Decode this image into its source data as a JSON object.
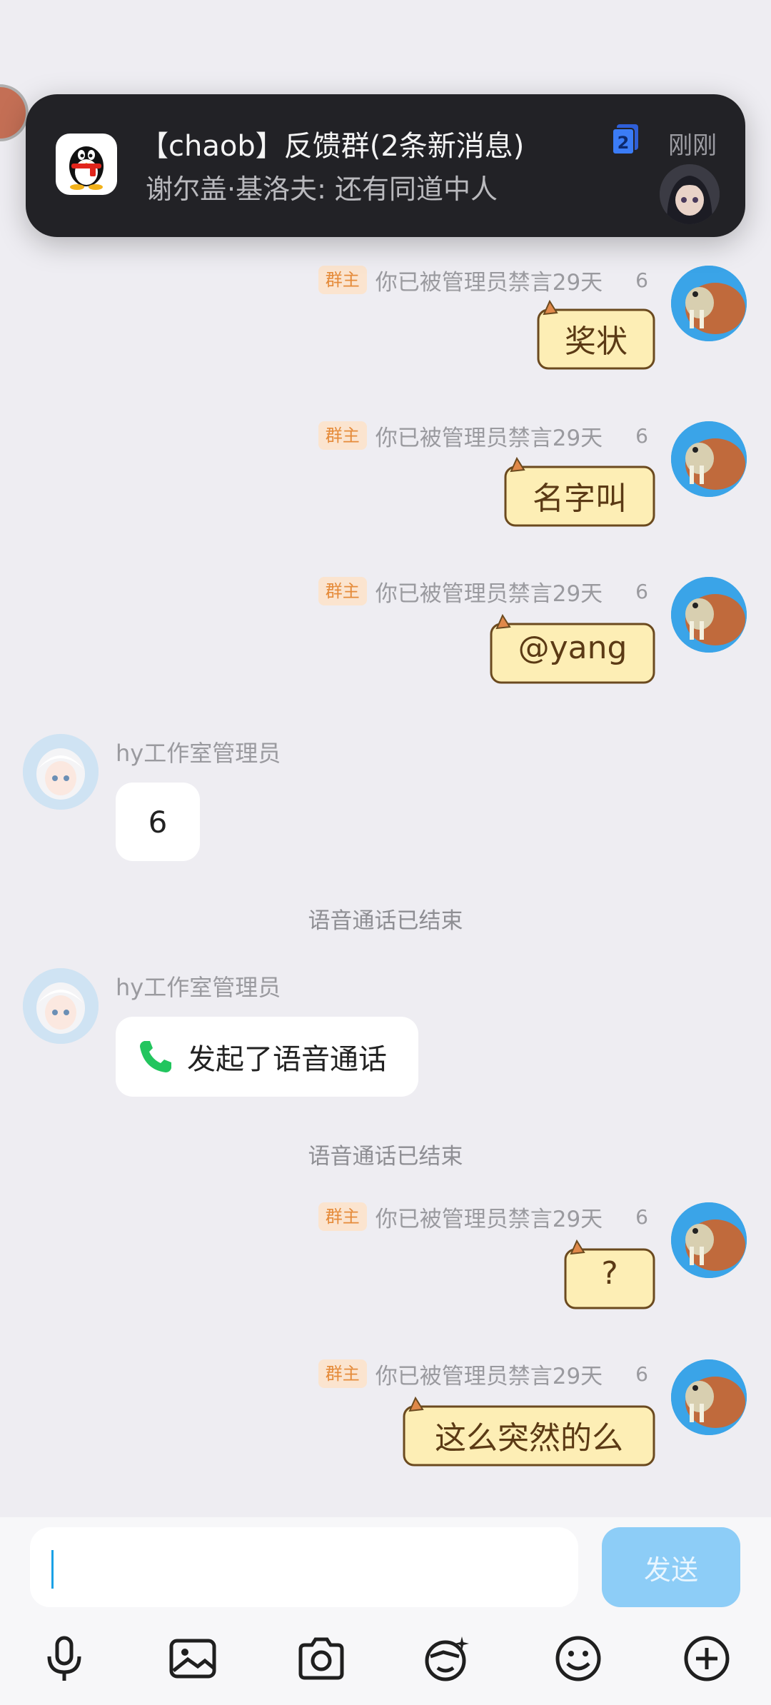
{
  "notification": {
    "title": "【chaob】反馈群(2条新消息)",
    "body": "谢尔盖·基洛夫: 还有同道中人",
    "count": "2",
    "time": "刚刚"
  },
  "messages": [
    {
      "badge": "群主",
      "status": "你已被管理员禁言29天",
      "level": "6",
      "text": "奖状"
    },
    {
      "badge": "群主",
      "status": "你已被管理员禁言29天",
      "level": "6",
      "text": "名字叫"
    },
    {
      "badge": "群主",
      "status": "你已被管理员禁言29天",
      "level": "6",
      "text": "@yang"
    },
    {
      "sender": "hy工作室管理员",
      "text": "6"
    },
    {
      "system": "语音通话已结束"
    },
    {
      "sender": "hy工作室管理员",
      "text": "发起了语音通话"
    },
    {
      "system": "语音通话已结束"
    },
    {
      "badge": "群主",
      "status": "你已被管理员禁言29天",
      "level": "6",
      "text": "?"
    },
    {
      "badge": "群主",
      "status": "你已被管理员禁言29天",
      "level": "6",
      "text": "这么突然的么"
    }
  ],
  "input": {
    "placeholder": "",
    "send_label": "发送"
  },
  "toolbar": [
    "microphone-icon",
    "image-icon",
    "camera-icon",
    "sticker-icon",
    "emoji-icon",
    "plus-icon"
  ],
  "colors": {
    "background": "#eeedf2",
    "notification_bg": "#222226",
    "owner_badge_bg": "#fbe4cf",
    "owner_badge_text": "#e58b3a",
    "send_button": "#8dcdf7",
    "call_icon": "#22c55e",
    "cat_bubble_fill": "#fdeeb5"
  }
}
